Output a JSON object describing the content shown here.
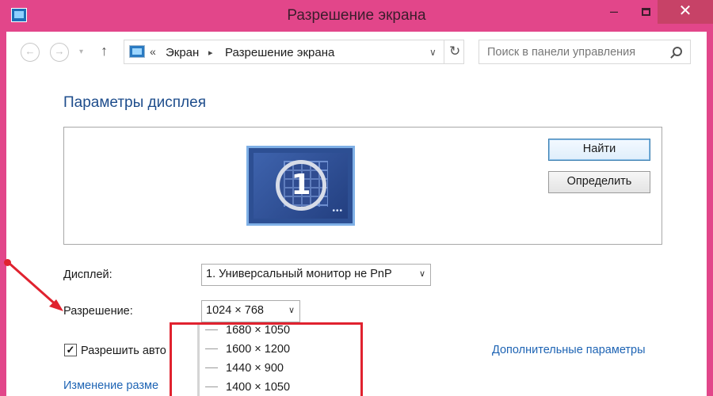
{
  "window": {
    "title": "Разрешение экрана",
    "controls": {
      "minimize": "–",
      "close": "✕"
    }
  },
  "nav": {
    "back": "←",
    "forward": "→",
    "history_drop": "▾",
    "up": "↑",
    "address_sep": "«",
    "breadcrumbs": [
      "Экран",
      "Разрешение экрана"
    ],
    "crumb_arrow": "▸",
    "address_dropdown": "∨",
    "refresh": "↻",
    "search_placeholder": "Поиск в панели управления"
  },
  "main": {
    "heading": "Параметры дисплея",
    "monitor_number": "1",
    "monitor_dots": "•••",
    "find_button": "Найти",
    "identify_button": "Определить",
    "display_label": "Дисплей:",
    "display_value": "1. Универсальный монитор не PnP",
    "resolution_label": "Разрешение:",
    "resolution_value": "1024 × 768",
    "dropdown_arrow": "∨",
    "auto_rotate_checked": true,
    "auto_rotate_label": "Разрешить авто",
    "advanced_link": "Дополнительные параметры",
    "change_size_link": "Изменение разме"
  },
  "resolution_options": [
    "1680 × 1050",
    "1600 × 1200",
    "1440 × 900",
    "1400 × 1050"
  ],
  "colors": {
    "window_frame": "#e2468a",
    "close_button": "#c74267",
    "link": "#1e64b4",
    "heading": "#1e4d8c",
    "annotation": "#e0222f"
  }
}
